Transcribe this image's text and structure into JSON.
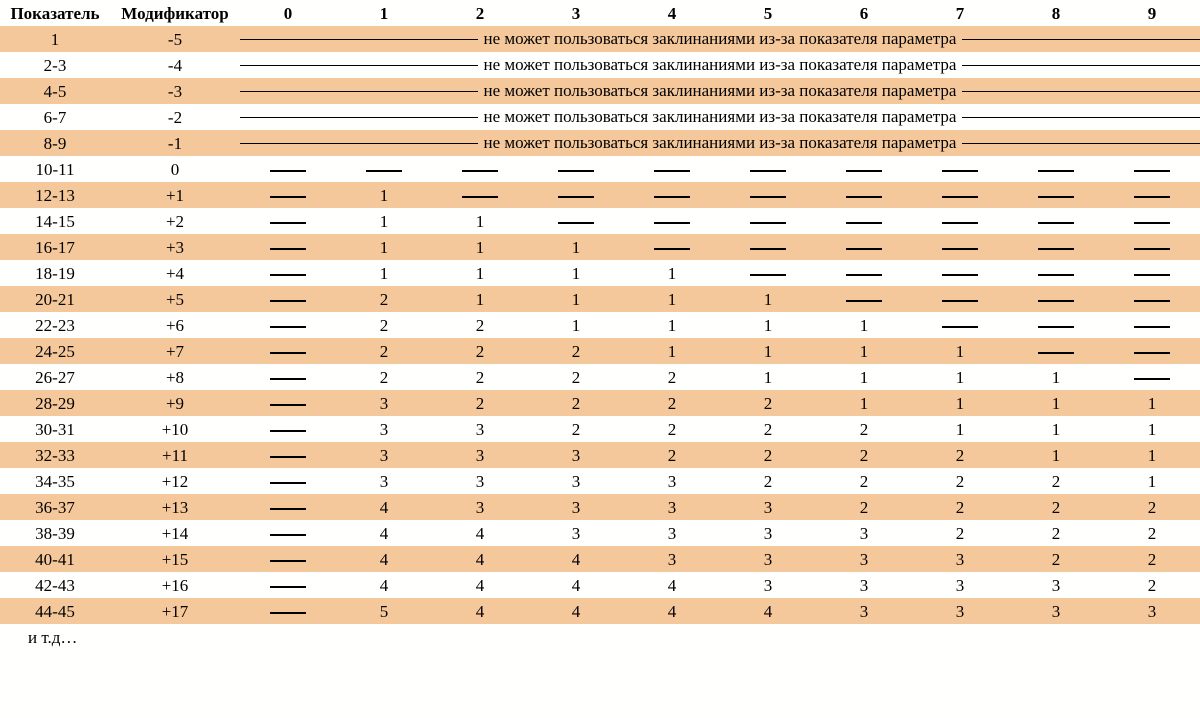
{
  "chart_data": {
    "type": "table",
    "title": "",
    "columns": [
      "Показатель",
      "Модификатор",
      "0",
      "1",
      "2",
      "3",
      "4",
      "5",
      "6",
      "7",
      "8",
      "9"
    ],
    "cannot_cast_message": "не  может пользоваться заклинаниями из-за показателя параметра",
    "footer": "и т.д…",
    "dash": "—",
    "rows": [
      {
        "score": "1",
        "mod": "-5",
        "msg": true
      },
      {
        "score": "2-3",
        "mod": "-4",
        "msg": true
      },
      {
        "score": "4-5",
        "mod": "-3",
        "msg": true
      },
      {
        "score": "6-7",
        "mod": "-2",
        "msg": true
      },
      {
        "score": "8-9",
        "mod": "-1",
        "msg": true
      },
      {
        "score": "10-11",
        "mod": "0",
        "cells": [
          "—",
          "—",
          "—",
          "—",
          "—",
          "—",
          "—",
          "—",
          "—",
          "—"
        ]
      },
      {
        "score": "12-13",
        "mod": "+1",
        "cells": [
          "—",
          "1",
          "—",
          "—",
          "—",
          "—",
          "—",
          "—",
          "—",
          "—"
        ]
      },
      {
        "score": "14-15",
        "mod": "+2",
        "cells": [
          "—",
          "1",
          "1",
          "—",
          "—",
          "—",
          "—",
          "—",
          "—",
          "—"
        ]
      },
      {
        "score": "16-17",
        "mod": "+3",
        "cells": [
          "—",
          "1",
          "1",
          "1",
          "—",
          "—",
          "—",
          "—",
          "—",
          "—"
        ]
      },
      {
        "score": "18-19",
        "mod": "+4",
        "cells": [
          "—",
          "1",
          "1",
          "1",
          "1",
          "—",
          "—",
          "—",
          "—",
          "—"
        ]
      },
      {
        "score": "20-21",
        "mod": "+5",
        "cells": [
          "—",
          "2",
          "1",
          "1",
          "1",
          "1",
          "—",
          "—",
          "—",
          "—"
        ]
      },
      {
        "score": "22-23",
        "mod": "+6",
        "cells": [
          "—",
          "2",
          "2",
          "1",
          "1",
          "1",
          "1",
          "—",
          "—",
          "—"
        ]
      },
      {
        "score": "24-25",
        "mod": "+7",
        "cells": [
          "—",
          "2",
          "2",
          "2",
          "1",
          "1",
          "1",
          "1",
          "—",
          "—"
        ]
      },
      {
        "score": "26-27",
        "mod": "+8",
        "cells": [
          "—",
          "2",
          "2",
          "2",
          "2",
          "1",
          "1",
          "1",
          "1",
          "—"
        ]
      },
      {
        "score": "28-29",
        "mod": "+9",
        "cells": [
          "—",
          "3",
          "2",
          "2",
          "2",
          "2",
          "1",
          "1",
          "1",
          "1"
        ]
      },
      {
        "score": "30-31",
        "mod": "+10",
        "cells": [
          "—",
          "3",
          "3",
          "2",
          "2",
          "2",
          "2",
          "1",
          "1",
          "1"
        ]
      },
      {
        "score": "32-33",
        "mod": "+11",
        "cells": [
          "—",
          "3",
          "3",
          "3",
          "2",
          "2",
          "2",
          "2",
          "1",
          "1"
        ]
      },
      {
        "score": "34-35",
        "mod": "+12",
        "cells": [
          "—",
          "3",
          "3",
          "3",
          "3",
          "2",
          "2",
          "2",
          "2",
          "1"
        ]
      },
      {
        "score": "36-37",
        "mod": "+13",
        "cells": [
          "—",
          "4",
          "3",
          "3",
          "3",
          "3",
          "2",
          "2",
          "2",
          "2"
        ]
      },
      {
        "score": "38-39",
        "mod": "+14",
        "cells": [
          "—",
          "4",
          "4",
          "3",
          "3",
          "3",
          "3",
          "2",
          "2",
          "2"
        ]
      },
      {
        "score": "40-41",
        "mod": "+15",
        "cells": [
          "—",
          "4",
          "4",
          "4",
          "3",
          "3",
          "3",
          "3",
          "2",
          "2"
        ]
      },
      {
        "score": "42-43",
        "mod": "+16",
        "cells": [
          "—",
          "4",
          "4",
          "4",
          "4",
          "3",
          "3",
          "3",
          "3",
          "2"
        ]
      },
      {
        "score": "44-45",
        "mod": "+17",
        "cells": [
          "—",
          "5",
          "4",
          "4",
          "4",
          "4",
          "3",
          "3",
          "3",
          "3"
        ]
      }
    ]
  }
}
